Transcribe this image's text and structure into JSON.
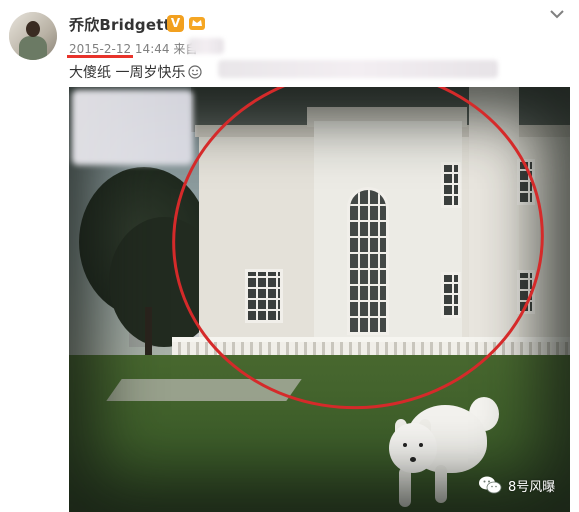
{
  "post": {
    "username": "乔欣Bridgette",
    "verified_badge": "V",
    "timestamp": "2015-2-12 14:44 来自",
    "text": "大傻纸 一周岁快乐"
  },
  "icons": {
    "avatar": "avatar",
    "member": "member-crown-icon",
    "chevron": "chevron-down-icon",
    "smile": "smile-emoji-icon",
    "watermark": "wechat-icon"
  },
  "watermark": {
    "text": "8号风曝"
  },
  "colors": {
    "annotation_red": "#d52a2a",
    "badge_orange": "#f2a01f"
  }
}
